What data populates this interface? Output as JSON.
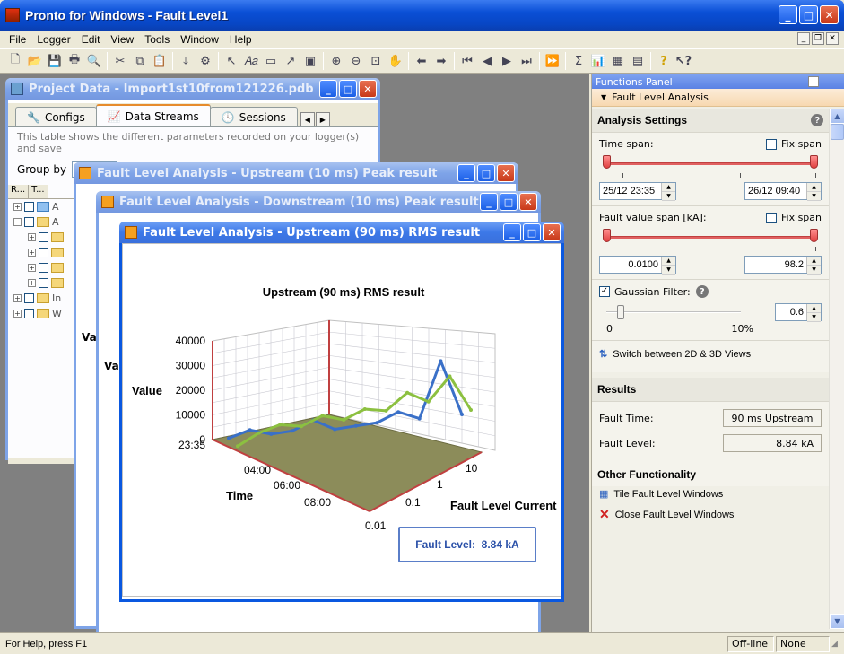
{
  "app": {
    "title": "Pronto for Windows - Fault Level1",
    "menu": [
      "File",
      "Logger",
      "Edit",
      "View",
      "Tools",
      "Window",
      "Help"
    ]
  },
  "project_window": {
    "title": "Project Data - Import1st10from121226.pdb",
    "tabs": [
      "Configs",
      "Data Streams",
      "Sessions"
    ],
    "description": "This table shows the different parameters recorded on your logger(s) and save",
    "group_by_label": "Group by",
    "tree_headers": [
      "R...",
      "T..."
    ],
    "tree_rows": [
      "A",
      "A",
      "",
      "",
      "",
      "",
      "In",
      "W"
    ]
  },
  "back_windows": [
    {
      "title": "Fault Level Analysis - Upstream (10 ms) Peak result",
      "fragment": "Va"
    },
    {
      "title": "Fault Level Analysis - Downstream (10 ms) Peak result",
      "fragment": "Va"
    }
  ],
  "chart_window": {
    "title": "Fault Level Analysis - Upstream (90 ms) RMS result",
    "readout": "Fault Level:  8.84 kA"
  },
  "chart_data": {
    "type": "surface",
    "title": "Upstream (90 ms) RMS result",
    "zlabel": "Value",
    "xlabel": "Time",
    "ylabel": "Fault Level Current",
    "z_ticks": [
      "0",
      "10000",
      "20000",
      "30000",
      "40000"
    ],
    "time_ticks": [
      "23:35",
      "04:00",
      "06:00",
      "08:00"
    ],
    "current_ticks": [
      "0.01",
      "0.1",
      "1",
      "10"
    ],
    "zlim": [
      0,
      40000
    ],
    "series": [
      {
        "color": "#3a70c8",
        "values": [
          2000,
          5000,
          3000,
          4000,
          8000,
          4000,
          5000,
          6000,
          10000,
          7000,
          30000,
          8000
        ]
      },
      {
        "color": "#8cc040",
        "values": [
          1000,
          6000,
          9000,
          8000,
          12000,
          10000,
          14000,
          13000,
          20000,
          16000,
          26000,
          12000
        ]
      }
    ],
    "colors": {
      "floor": "#8c8c5a",
      "axis": "#c04040",
      "grid": "#c8c8d0"
    }
  },
  "functions_panel": {
    "header": "Functions Panel",
    "section": "Fault Level Analysis",
    "analysis_title": "Analysis Settings",
    "time_span_label": "Time span:",
    "fix_span_label": "Fix span",
    "time_start": "25/12 23:35",
    "time_end": "26/12 09:40",
    "fault_span_label": "Fault value span [kA]:",
    "fault_min": "0.0100",
    "fault_max": "98.2",
    "gaussian_label": "Gaussian Filter:",
    "gaussian_checked": true,
    "gaussian_value": "0.6",
    "slider_min": "0",
    "slider_max": "10%",
    "switch_label": "Switch between 2D & 3D Views",
    "results_title": "Results",
    "fault_time_label": "Fault Time:",
    "fault_time_value": "90 ms Upstream",
    "fault_level_label": "Fault Level:",
    "fault_level_value": "8.84 kA",
    "other_title": "Other Functionality",
    "tile_label": "Tile Fault Level Windows",
    "close_label": "Close Fault Level Windows"
  },
  "status": {
    "help": "For Help, press F1",
    "mode": "Off-line",
    "extra": "None"
  }
}
